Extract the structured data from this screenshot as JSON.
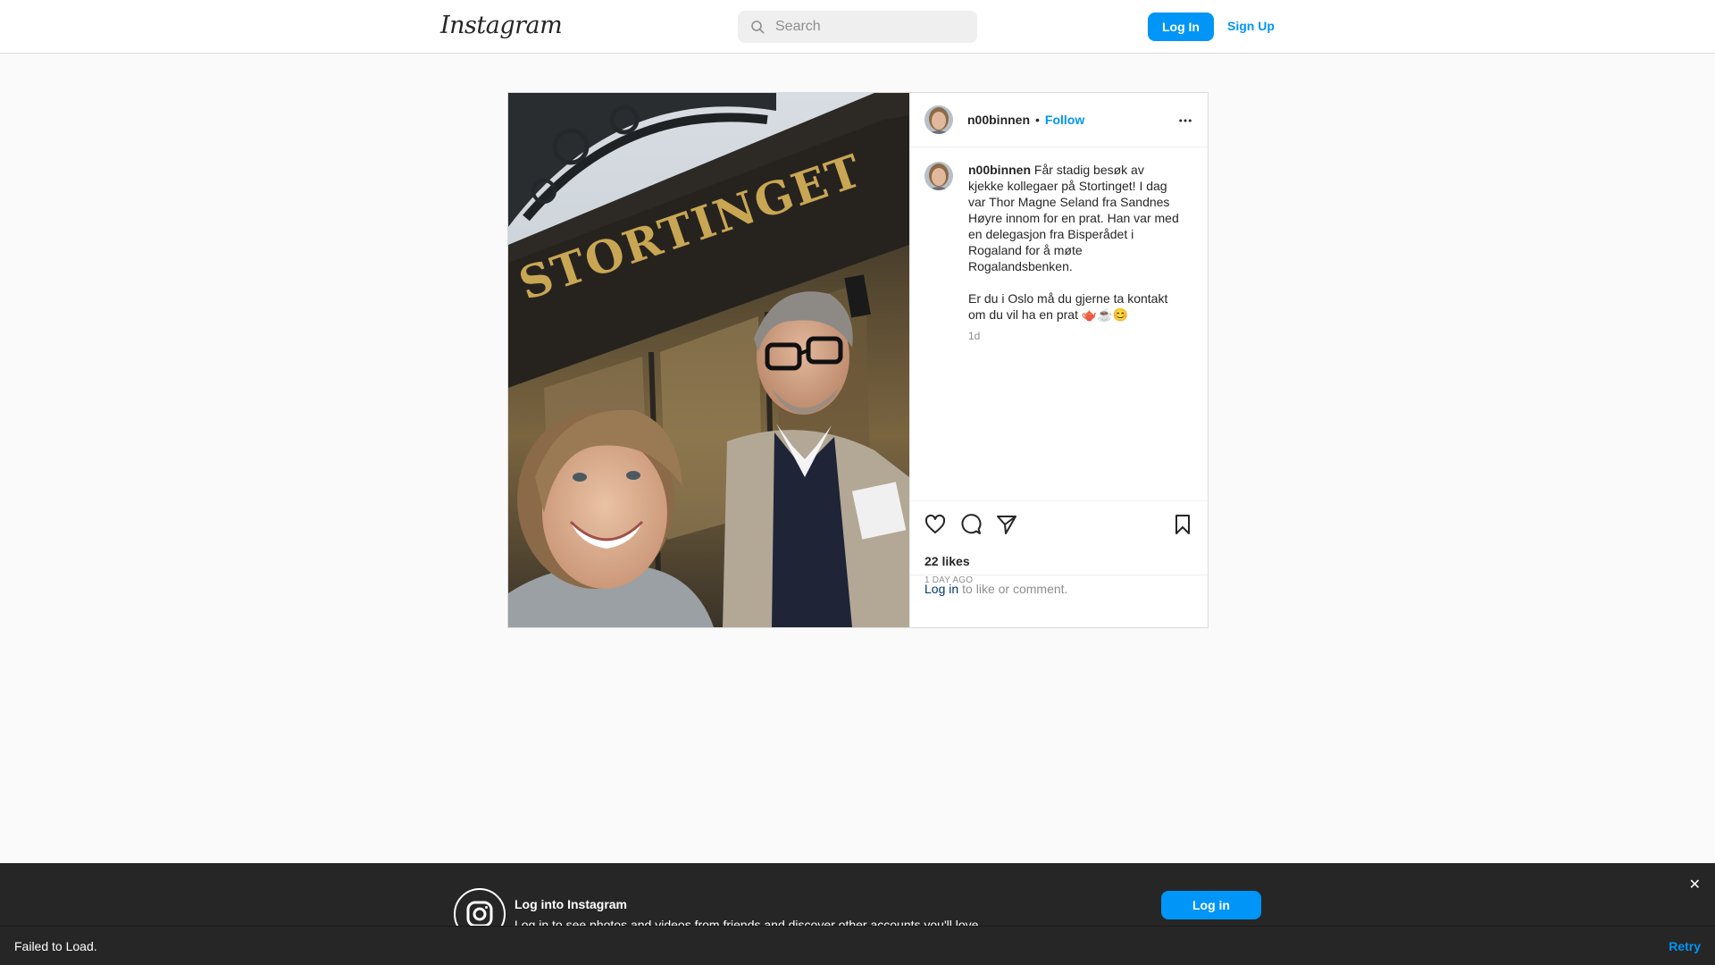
{
  "header": {
    "logo_text": "Instagram",
    "search_placeholder": "Search",
    "login_label": "Log In",
    "signup_label": "Sign Up"
  },
  "post": {
    "username": "n00binnen",
    "follow_label": "Follow",
    "separator": "•",
    "caption_user": "n00binnen",
    "caption_text": "Får stadig besøk av kjekke kollegaer på Stortinget! I dag var Thor Magne Seland fra Sandnes Høyre innom for en prat. Han var med en delegasjon fra Bisperådet i Rogaland for å møte Rogalandsbenken.\n\nEr du i Oslo må du gjerne ta kontakt om du vil ha en prat 🫖☕😊",
    "caption_age": "1d",
    "photo_sign_text": "STORTINGET",
    "likes": "22 likes",
    "time_ago": "1 DAY AGO",
    "login_link": "Log in",
    "login_prompt": "to like or comment."
  },
  "banner": {
    "title": "Log into Instagram",
    "subtitle": "Log in to see photos and videos from friends and discover other accounts you'll love.",
    "button_label": "Log in",
    "close_label": "✕"
  },
  "toast": {
    "message": "Failed to Load.",
    "retry_label": "Retry"
  },
  "colors": {
    "accent": "#0095f6",
    "border": "#dbdbdb",
    "text": "#262626",
    "muted": "#8e8e8e",
    "dark_bar": "#262626"
  }
}
